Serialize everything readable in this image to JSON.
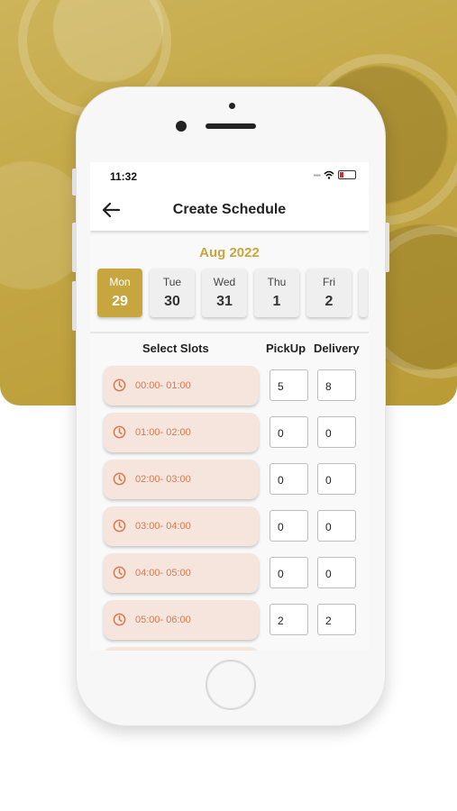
{
  "status": {
    "time": "11:32"
  },
  "header": {
    "title": "Create Schedule"
  },
  "calendar": {
    "month": "Aug 2022",
    "days": [
      {
        "name": "Mon",
        "date": "29",
        "selected": true
      },
      {
        "name": "Tue",
        "date": "30",
        "selected": false
      },
      {
        "name": "Wed",
        "date": "31",
        "selected": false
      },
      {
        "name": "Thu",
        "date": "1",
        "selected": false
      },
      {
        "name": "Fri",
        "date": "2",
        "selected": false
      }
    ]
  },
  "table": {
    "headers": {
      "slots": "Select Slots",
      "pickup": "PickUp",
      "delivery": "Delivery"
    },
    "rows": [
      {
        "slot": "00:00- 01:00",
        "pickup": "5",
        "delivery": "8"
      },
      {
        "slot": "01:00- 02:00",
        "pickup": "0",
        "delivery": "0"
      },
      {
        "slot": "02:00- 03:00",
        "pickup": "0",
        "delivery": "0"
      },
      {
        "slot": "03:00- 04:00",
        "pickup": "0",
        "delivery": "0"
      },
      {
        "slot": "04:00- 05:00",
        "pickup": "0",
        "delivery": "0"
      },
      {
        "slot": "05:00- 06:00",
        "pickup": "2",
        "delivery": "2"
      }
    ]
  },
  "colors": {
    "accent": "#c8a63f",
    "slot_bg": "#f5e5dd",
    "slot_text": "#d47a52"
  },
  "icons": {
    "back": "arrow-left-icon",
    "slot": "clock-icon"
  }
}
